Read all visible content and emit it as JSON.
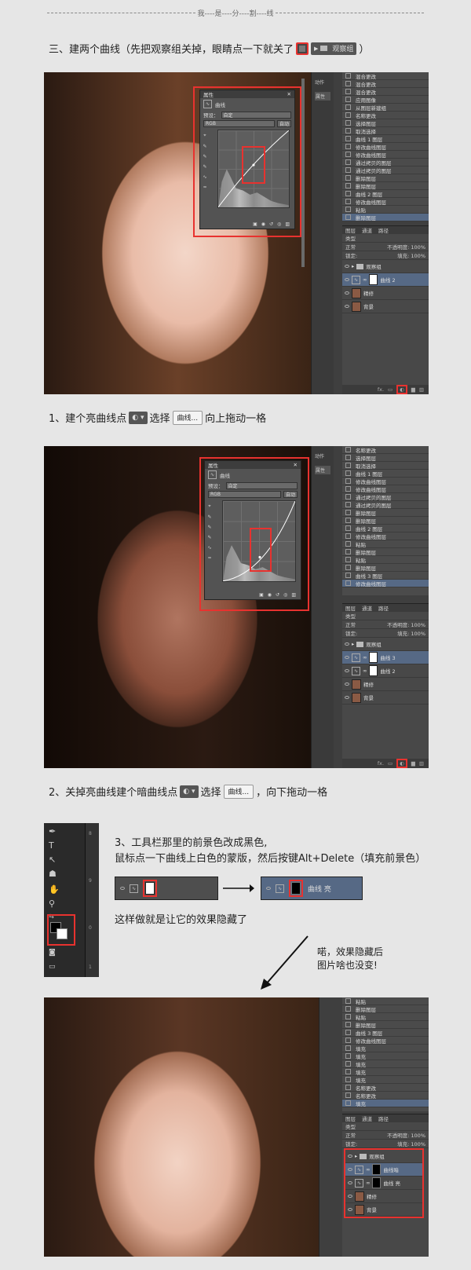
{
  "divider": {
    "text": "--------------------------------------------------------我----是----分----割----线--------------------------------------------------------"
  },
  "step3": {
    "text_before": "三、建两个曲线（先把观察组关掉，眼睛点一下就关了",
    "group_label": "观察组",
    "text_after": "）"
  },
  "step_1": {
    "text_before": "1、建个亮曲线点",
    "text_mid": "选择",
    "button_label": "曲线...",
    "text_after": "向上拖动一格"
  },
  "step_2": {
    "text_before": "2、关掉亮曲线建个暗曲线点",
    "text_mid": "选择",
    "button_label": "曲线...",
    "text_after": "，向下拖动一格"
  },
  "step_3_tip": {
    "line1": "3、工具栏那里的前景色改成黑色,",
    "line2": "鼠标点一下曲线上白色的蒙版，然后按键Alt+Delete（填充前景色）",
    "line3": "这样做就是让它的效果隐藏了",
    "layer_name": "曲线 亮",
    "callout": "喏，效果隐藏后\n图片啥也没变!"
  },
  "panels": {
    "props_title": "属性",
    "curves_label": "曲线",
    "preset_label": "预设：",
    "preset_value": "自定",
    "channel_value": "RGB",
    "auto_label": "自动",
    "actions_tab": "动作",
    "props_tab": "属性",
    "layers_tab": "图层",
    "channels_tab": "通道",
    "paths_tab": "路径",
    "kind_label": "类型",
    "blend_mode": "正常",
    "opacity_label": "不透明度:",
    "opacity_value": "100%",
    "lock_label": "锁定:",
    "fill_label": "填充:",
    "fill_value": "100%",
    "fx_label": "fx."
  },
  "history_1": [
    "混合更改",
    "混合更改",
    "混合更改",
    "应用图像",
    "从图层新建组",
    "名称更改",
    "选择图层",
    "取消选择",
    "曲线 1 图层",
    "修改曲线图层",
    "修改曲线图层",
    "通过拷贝的图层",
    "通过拷贝的图层",
    "删除图层",
    "删除图层",
    "曲线 2 图层",
    "修改曲线图层",
    "粘贴",
    "删除图层"
  ],
  "history_2": [
    "名称更改",
    "选择图层",
    "取消选择",
    "曲线 1 图层",
    "修改曲线图层",
    "修改曲线图层",
    "通过拷贝的图层",
    "通过拷贝的图层",
    "删除图层",
    "删除图层",
    "曲线 2 图层",
    "修改曲线图层",
    "粘贴",
    "删除图层",
    "粘贴",
    "删除图层",
    "曲线 3 图层",
    "修改曲线图层"
  ],
  "history_3": [
    "粘贴",
    "删除图层",
    "粘贴",
    "删除图层",
    "曲线 3 图层",
    "修改曲线图层",
    "填充",
    "填充",
    "填充",
    "填充",
    "填充",
    "名称更改",
    "名称更改",
    "填充"
  ],
  "layers_1": [
    {
      "name": "观察组",
      "type": "group"
    },
    {
      "name": "曲线 2",
      "type": "curve-white",
      "selected": true
    },
    {
      "name": "精修",
      "type": "photo"
    },
    {
      "name": "背景",
      "type": "photo"
    }
  ],
  "layers_2": [
    {
      "name": "观察组",
      "type": "group"
    },
    {
      "name": "曲线 3",
      "type": "curve-white",
      "selected": true
    },
    {
      "name": "曲线 2",
      "type": "curve-white"
    },
    {
      "name": "精修",
      "type": "photo"
    },
    {
      "name": "背景",
      "type": "photo"
    }
  ],
  "layers_3": [
    {
      "name": "观察组",
      "type": "group"
    },
    {
      "name": "曲线暗",
      "type": "curve-black",
      "selected": true
    },
    {
      "name": "曲线 亮",
      "type": "curve-black"
    },
    {
      "name": "精修",
      "type": "photo"
    },
    {
      "name": "背景",
      "type": "photo"
    }
  ],
  "ruler_numbers": [
    "8",
    "9",
    "0",
    "1"
  ]
}
